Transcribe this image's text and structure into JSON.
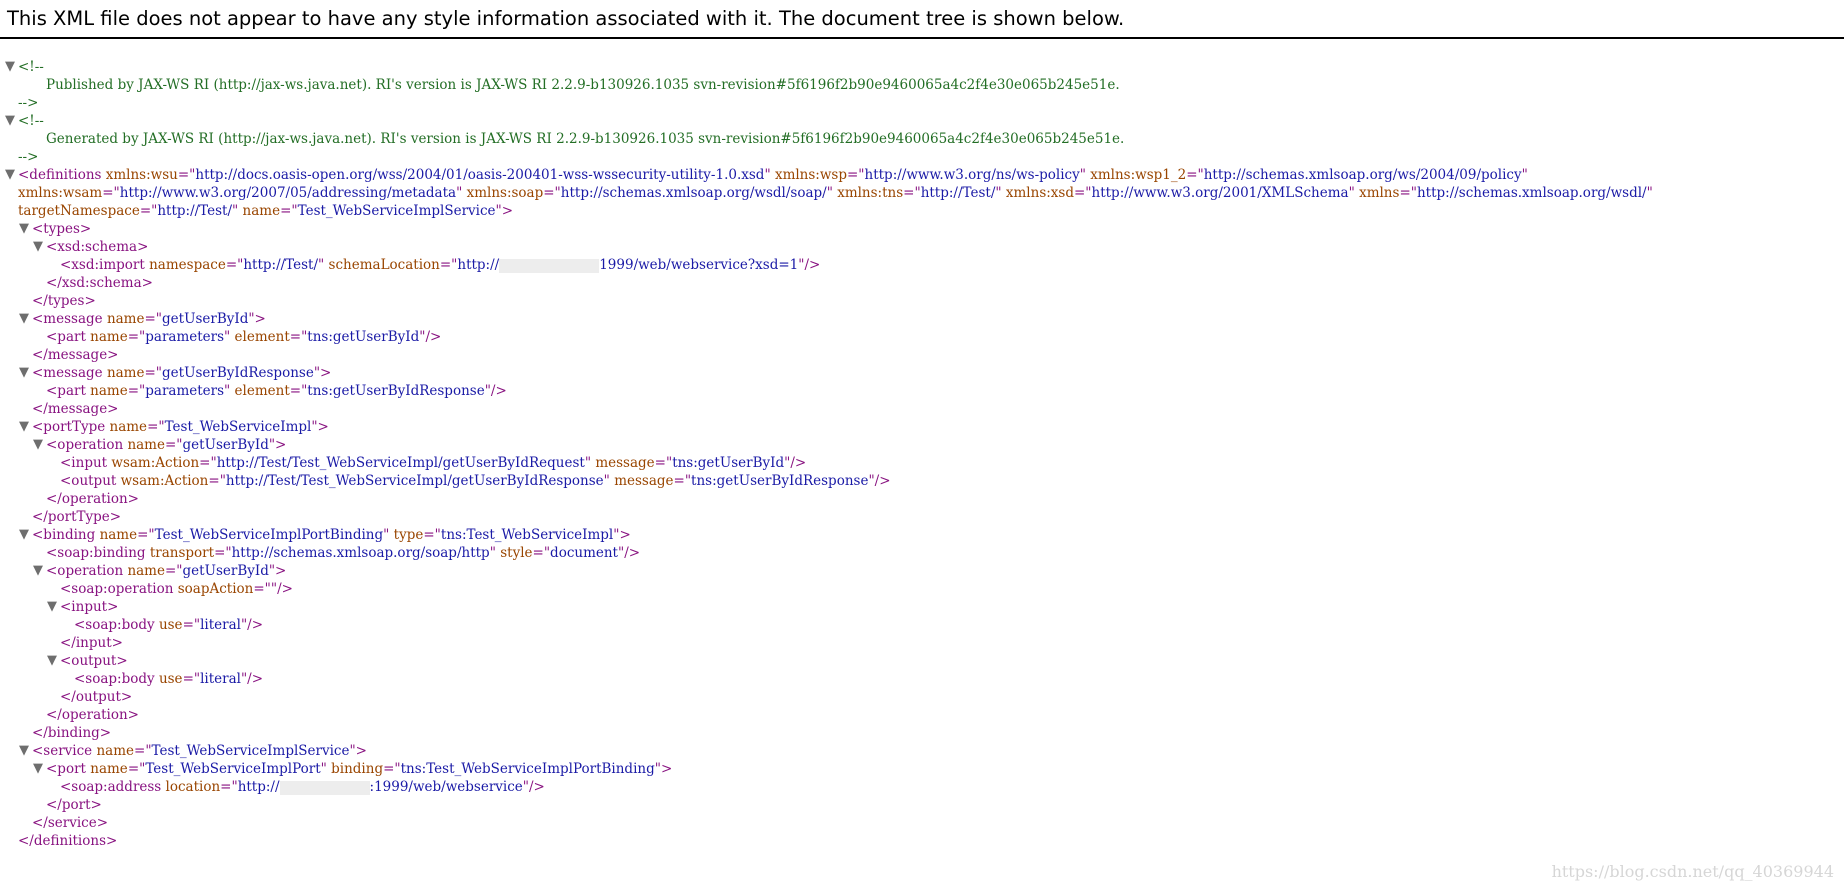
{
  "header": "This XML file does not appear to have any style information associated with it. The document tree is shown below.",
  "toggle_glyph": "▼",
  "colors": {
    "tag": "#881280",
    "attr_name": "#994500",
    "attr_value": "#1a1aa6",
    "comment": "#236e25"
  },
  "lines": [
    {
      "indent": 0,
      "toggle": true,
      "parts": [
        {
          "k": "cm",
          "t": "<!--"
        }
      ]
    },
    {
      "indent": 2,
      "parts": [
        {
          "k": "cm",
          "t": "Published by JAX-WS RI (http://jax-ws.java.net). RI's version is JAX-WS RI 2.2.9-b130926.1035 svn-revision#5f6196f2b90e9460065a4c2f4e30e065b245e51e."
        }
      ]
    },
    {
      "indent": 0,
      "parts": [
        {
          "k": "cm",
          "t": "-->"
        }
      ]
    },
    {
      "indent": 0,
      "toggle": true,
      "parts": [
        {
          "k": "cm",
          "t": "<!--"
        }
      ]
    },
    {
      "indent": 2,
      "parts": [
        {
          "k": "cm",
          "t": "Generated by JAX-WS RI (http://jax-ws.java.net). RI's version is JAX-WS RI 2.2.9-b130926.1035 svn-revision#5f6196f2b90e9460065a4c2f4e30e065b245e51e."
        }
      ]
    },
    {
      "indent": 0,
      "parts": [
        {
          "k": "cm",
          "t": "-->"
        }
      ]
    },
    {
      "indent": 0,
      "toggle": true,
      "parts": [
        {
          "k": "tag",
          "t": "<definitions "
        },
        {
          "k": "an",
          "t": "xmlns:wsu"
        },
        {
          "k": "tag",
          "t": "=\""
        },
        {
          "k": "av",
          "t": "http://docs.oasis-open.org/wss/2004/01/oasis-200401-wss-wssecurity-utility-1.0.xsd"
        },
        {
          "k": "tag",
          "t": "\" "
        },
        {
          "k": "an",
          "t": "xmlns:wsp"
        },
        {
          "k": "tag",
          "t": "=\""
        },
        {
          "k": "av",
          "t": "http://www.w3.org/ns/ws-policy"
        },
        {
          "k": "tag",
          "t": "\" "
        },
        {
          "k": "an",
          "t": "xmlns:wsp1_2"
        },
        {
          "k": "tag",
          "t": "=\""
        },
        {
          "k": "av",
          "t": "http://schemas.xmlsoap.org/ws/2004/09/policy"
        },
        {
          "k": "tag",
          "t": "\""
        }
      ]
    },
    {
      "indent": 0,
      "parts": [
        {
          "k": "an",
          "t": "xmlns:wsam"
        },
        {
          "k": "tag",
          "t": "=\""
        },
        {
          "k": "av",
          "t": "http://www.w3.org/2007/05/addressing/metadata"
        },
        {
          "k": "tag",
          "t": "\" "
        },
        {
          "k": "an",
          "t": "xmlns:soap"
        },
        {
          "k": "tag",
          "t": "=\""
        },
        {
          "k": "av",
          "t": "http://schemas.xmlsoap.org/wsdl/soap/"
        },
        {
          "k": "tag",
          "t": "\" "
        },
        {
          "k": "an",
          "t": "xmlns:tns"
        },
        {
          "k": "tag",
          "t": "=\""
        },
        {
          "k": "av",
          "t": "http://Test/"
        },
        {
          "k": "tag",
          "t": "\" "
        },
        {
          "k": "an",
          "t": "xmlns:xsd"
        },
        {
          "k": "tag",
          "t": "=\""
        },
        {
          "k": "av",
          "t": "http://www.w3.org/2001/XMLSchema"
        },
        {
          "k": "tag",
          "t": "\" "
        },
        {
          "k": "an",
          "t": "xmlns"
        },
        {
          "k": "tag",
          "t": "=\""
        },
        {
          "k": "av",
          "t": "http://schemas.xmlsoap.org/wsdl/"
        },
        {
          "k": "tag",
          "t": "\""
        }
      ]
    },
    {
      "indent": 0,
      "parts": [
        {
          "k": "an",
          "t": "targetNamespace"
        },
        {
          "k": "tag",
          "t": "=\""
        },
        {
          "k": "av",
          "t": "http://Test/"
        },
        {
          "k": "tag",
          "t": "\" "
        },
        {
          "k": "an",
          "t": "name"
        },
        {
          "k": "tag",
          "t": "=\""
        },
        {
          "k": "av",
          "t": "Test_WebServiceImplService"
        },
        {
          "k": "tag",
          "t": "\">"
        }
      ]
    },
    {
      "indent": 1,
      "toggle": true,
      "parts": [
        {
          "k": "tag",
          "t": "<types>"
        }
      ]
    },
    {
      "indent": 2,
      "toggle": true,
      "parts": [
        {
          "k": "tag",
          "t": "<xsd:schema>"
        }
      ]
    },
    {
      "indent": 3,
      "parts": [
        {
          "k": "tag",
          "t": "<xsd:import "
        },
        {
          "k": "an",
          "t": "namespace"
        },
        {
          "k": "tag",
          "t": "=\""
        },
        {
          "k": "av",
          "t": "http://Test/"
        },
        {
          "k": "tag",
          "t": "\" "
        },
        {
          "k": "an",
          "t": "schemaLocation"
        },
        {
          "k": "tag",
          "t": "=\""
        },
        {
          "k": "av",
          "t": "http://"
        },
        {
          "k": "mask",
          "w": 100
        },
        {
          "k": "av",
          "t": "1999/web/webservice?xsd=1"
        },
        {
          "k": "tag",
          "t": "\"/>"
        }
      ]
    },
    {
      "indent": 2,
      "parts": [
        {
          "k": "tag",
          "t": "</xsd:schema>"
        }
      ]
    },
    {
      "indent": 1,
      "parts": [
        {
          "k": "tag",
          "t": "</types>"
        }
      ]
    },
    {
      "indent": 1,
      "toggle": true,
      "parts": [
        {
          "k": "tag",
          "t": "<message "
        },
        {
          "k": "an",
          "t": "name"
        },
        {
          "k": "tag",
          "t": "=\""
        },
        {
          "k": "av",
          "t": "getUserById"
        },
        {
          "k": "tag",
          "t": "\">"
        }
      ]
    },
    {
      "indent": 2,
      "parts": [
        {
          "k": "tag",
          "t": "<part "
        },
        {
          "k": "an",
          "t": "name"
        },
        {
          "k": "tag",
          "t": "=\""
        },
        {
          "k": "av",
          "t": "parameters"
        },
        {
          "k": "tag",
          "t": "\" "
        },
        {
          "k": "an",
          "t": "element"
        },
        {
          "k": "tag",
          "t": "=\""
        },
        {
          "k": "av",
          "t": "tns:getUserById"
        },
        {
          "k": "tag",
          "t": "\"/>"
        }
      ]
    },
    {
      "indent": 1,
      "parts": [
        {
          "k": "tag",
          "t": "</message>"
        }
      ]
    },
    {
      "indent": 1,
      "toggle": true,
      "parts": [
        {
          "k": "tag",
          "t": "<message "
        },
        {
          "k": "an",
          "t": "name"
        },
        {
          "k": "tag",
          "t": "=\""
        },
        {
          "k": "av",
          "t": "getUserByIdResponse"
        },
        {
          "k": "tag",
          "t": "\">"
        }
      ]
    },
    {
      "indent": 2,
      "parts": [
        {
          "k": "tag",
          "t": "<part "
        },
        {
          "k": "an",
          "t": "name"
        },
        {
          "k": "tag",
          "t": "=\""
        },
        {
          "k": "av",
          "t": "parameters"
        },
        {
          "k": "tag",
          "t": "\" "
        },
        {
          "k": "an",
          "t": "element"
        },
        {
          "k": "tag",
          "t": "=\""
        },
        {
          "k": "av",
          "t": "tns:getUserByIdResponse"
        },
        {
          "k": "tag",
          "t": "\"/>"
        }
      ]
    },
    {
      "indent": 1,
      "parts": [
        {
          "k": "tag",
          "t": "</message>"
        }
      ]
    },
    {
      "indent": 1,
      "toggle": true,
      "parts": [
        {
          "k": "tag",
          "t": "<portType "
        },
        {
          "k": "an",
          "t": "name"
        },
        {
          "k": "tag",
          "t": "=\""
        },
        {
          "k": "av",
          "t": "Test_WebServiceImpl"
        },
        {
          "k": "tag",
          "t": "\">"
        }
      ]
    },
    {
      "indent": 2,
      "toggle": true,
      "parts": [
        {
          "k": "tag",
          "t": "<operation "
        },
        {
          "k": "an",
          "t": "name"
        },
        {
          "k": "tag",
          "t": "=\""
        },
        {
          "k": "av",
          "t": "getUserById"
        },
        {
          "k": "tag",
          "t": "\">"
        }
      ]
    },
    {
      "indent": 3,
      "parts": [
        {
          "k": "tag",
          "t": "<input "
        },
        {
          "k": "an",
          "t": "wsam:Action"
        },
        {
          "k": "tag",
          "t": "=\""
        },
        {
          "k": "av",
          "t": "http://Test/Test_WebServiceImpl/getUserByIdRequest"
        },
        {
          "k": "tag",
          "t": "\" "
        },
        {
          "k": "an",
          "t": "message"
        },
        {
          "k": "tag",
          "t": "=\""
        },
        {
          "k": "av",
          "t": "tns:getUserById"
        },
        {
          "k": "tag",
          "t": "\"/>"
        }
      ]
    },
    {
      "indent": 3,
      "parts": [
        {
          "k": "tag",
          "t": "<output "
        },
        {
          "k": "an",
          "t": "wsam:Action"
        },
        {
          "k": "tag",
          "t": "=\""
        },
        {
          "k": "av",
          "t": "http://Test/Test_WebServiceImpl/getUserByIdResponse"
        },
        {
          "k": "tag",
          "t": "\" "
        },
        {
          "k": "an",
          "t": "message"
        },
        {
          "k": "tag",
          "t": "=\""
        },
        {
          "k": "av",
          "t": "tns:getUserByIdResponse"
        },
        {
          "k": "tag",
          "t": "\"/>"
        }
      ]
    },
    {
      "indent": 2,
      "parts": [
        {
          "k": "tag",
          "t": "</operation>"
        }
      ]
    },
    {
      "indent": 1,
      "parts": [
        {
          "k": "tag",
          "t": "</portType>"
        }
      ]
    },
    {
      "indent": 1,
      "toggle": true,
      "parts": [
        {
          "k": "tag",
          "t": "<binding "
        },
        {
          "k": "an",
          "t": "name"
        },
        {
          "k": "tag",
          "t": "=\""
        },
        {
          "k": "av",
          "t": "Test_WebServiceImplPortBinding"
        },
        {
          "k": "tag",
          "t": "\" "
        },
        {
          "k": "an",
          "t": "type"
        },
        {
          "k": "tag",
          "t": "=\""
        },
        {
          "k": "av",
          "t": "tns:Test_WebServiceImpl"
        },
        {
          "k": "tag",
          "t": "\">"
        }
      ]
    },
    {
      "indent": 2,
      "parts": [
        {
          "k": "tag",
          "t": "<soap:binding "
        },
        {
          "k": "an",
          "t": "transport"
        },
        {
          "k": "tag",
          "t": "=\""
        },
        {
          "k": "av",
          "t": "http://schemas.xmlsoap.org/soap/http"
        },
        {
          "k": "tag",
          "t": "\" "
        },
        {
          "k": "an",
          "t": "style"
        },
        {
          "k": "tag",
          "t": "=\""
        },
        {
          "k": "av",
          "t": "document"
        },
        {
          "k": "tag",
          "t": "\"/>"
        }
      ]
    },
    {
      "indent": 2,
      "toggle": true,
      "parts": [
        {
          "k": "tag",
          "t": "<operation "
        },
        {
          "k": "an",
          "t": "name"
        },
        {
          "k": "tag",
          "t": "=\""
        },
        {
          "k": "av",
          "t": "getUserById"
        },
        {
          "k": "tag",
          "t": "\">"
        }
      ]
    },
    {
      "indent": 3,
      "parts": [
        {
          "k": "tag",
          "t": "<soap:operation "
        },
        {
          "k": "an",
          "t": "soapAction"
        },
        {
          "k": "tag",
          "t": "=\"\"/>"
        }
      ]
    },
    {
      "indent": 3,
      "toggle": true,
      "parts": [
        {
          "k": "tag",
          "t": "<input>"
        }
      ]
    },
    {
      "indent": 4,
      "parts": [
        {
          "k": "tag",
          "t": "<soap:body "
        },
        {
          "k": "an",
          "t": "use"
        },
        {
          "k": "tag",
          "t": "=\""
        },
        {
          "k": "av",
          "t": "literal"
        },
        {
          "k": "tag",
          "t": "\"/>"
        }
      ]
    },
    {
      "indent": 3,
      "parts": [
        {
          "k": "tag",
          "t": "</input>"
        }
      ]
    },
    {
      "indent": 3,
      "toggle": true,
      "parts": [
        {
          "k": "tag",
          "t": "<output>"
        }
      ]
    },
    {
      "indent": 4,
      "parts": [
        {
          "k": "tag",
          "t": "<soap:body "
        },
        {
          "k": "an",
          "t": "use"
        },
        {
          "k": "tag",
          "t": "=\""
        },
        {
          "k": "av",
          "t": "literal"
        },
        {
          "k": "tag",
          "t": "\"/>"
        }
      ]
    },
    {
      "indent": 3,
      "parts": [
        {
          "k": "tag",
          "t": "</output>"
        }
      ]
    },
    {
      "indent": 2,
      "parts": [
        {
          "k": "tag",
          "t": "</operation>"
        }
      ]
    },
    {
      "indent": 1,
      "parts": [
        {
          "k": "tag",
          "t": "</binding>"
        }
      ]
    },
    {
      "indent": 1,
      "toggle": true,
      "parts": [
        {
          "k": "tag",
          "t": "<service "
        },
        {
          "k": "an",
          "t": "name"
        },
        {
          "k": "tag",
          "t": "=\""
        },
        {
          "k": "av",
          "t": "Test_WebServiceImplService"
        },
        {
          "k": "tag",
          "t": "\">"
        }
      ]
    },
    {
      "indent": 2,
      "toggle": true,
      "parts": [
        {
          "k": "tag",
          "t": "<port "
        },
        {
          "k": "an",
          "t": "name"
        },
        {
          "k": "tag",
          "t": "=\""
        },
        {
          "k": "av",
          "t": "Test_WebServiceImplPort"
        },
        {
          "k": "tag",
          "t": "\" "
        },
        {
          "k": "an",
          "t": "binding"
        },
        {
          "k": "tag",
          "t": "=\""
        },
        {
          "k": "av",
          "t": "tns:Test_WebServiceImplPortBinding"
        },
        {
          "k": "tag",
          "t": "\">"
        }
      ]
    },
    {
      "indent": 3,
      "parts": [
        {
          "k": "tag",
          "t": "<soap:address "
        },
        {
          "k": "an",
          "t": "location"
        },
        {
          "k": "tag",
          "t": "=\""
        },
        {
          "k": "av",
          "t": "http://"
        },
        {
          "k": "mask",
          "w": 90
        },
        {
          "k": "av",
          "t": ":1999/web/webservice"
        },
        {
          "k": "tag",
          "t": "\"/>"
        }
      ]
    },
    {
      "indent": 2,
      "parts": [
        {
          "k": "tag",
          "t": "</port>"
        }
      ]
    },
    {
      "indent": 1,
      "parts": [
        {
          "k": "tag",
          "t": "</service>"
        }
      ]
    },
    {
      "indent": 0,
      "parts": [
        {
          "k": "tag",
          "t": "</definitions>"
        }
      ]
    }
  ],
  "watermark": "https://blog.csdn.net/qq_40369944"
}
